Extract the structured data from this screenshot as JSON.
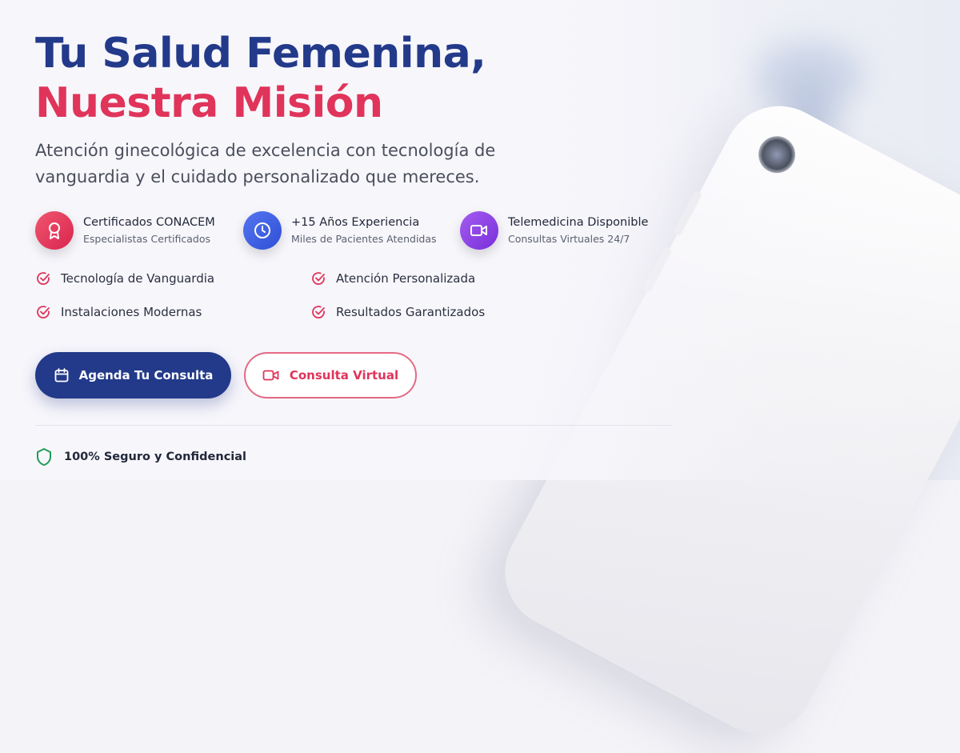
{
  "hero": {
    "title_line1": "Tu Salud Femenina,",
    "title_line2": "Nuestra Misión",
    "subtitle": "Atención ginecológica de excelencia con tecnología de vanguardia y el cuidado personalizado que mereces."
  },
  "features": [
    {
      "title": "Certificados CONACEM",
      "subtitle": "Especialistas Certificados",
      "icon": "award-icon",
      "color": "#e0345a"
    },
    {
      "title": "+15 Años Experiencia",
      "subtitle": "Miles de Pacientes Atendidas",
      "icon": "clock-icon",
      "color": "#3b5fe0"
    },
    {
      "title": "Telemedicina Disponible",
      "subtitle": "Consultas Virtuales 24/7",
      "icon": "video-icon",
      "color": "#8b3ee0"
    }
  ],
  "checklist": [
    {
      "label": "Tecnología de Vanguardia",
      "icon": "check-circle-icon"
    },
    {
      "label": "Atención Personalizada",
      "icon": "check-circle-icon"
    },
    {
      "label": "Instalaciones Modernas",
      "icon": "check-circle-icon"
    },
    {
      "label": "Resultados Garantizados",
      "icon": "check-circle-icon"
    }
  ],
  "buttons": {
    "primary": {
      "label": "Agenda Tu Consulta",
      "icon": "calendar-icon"
    },
    "secondary": {
      "label": "Consulta Virtual",
      "icon": "video-icon"
    }
  },
  "security": {
    "label": "100% Seguro y Confidencial",
    "icon": "shield-icon"
  },
  "colors": {
    "navy": "#233a8a",
    "accent": "#e0345a",
    "check": "#e0345a"
  }
}
